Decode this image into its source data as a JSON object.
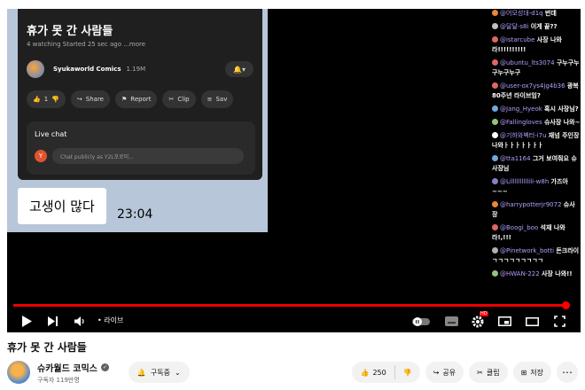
{
  "video": {
    "phone_screen": {
      "title": "휴가 못 간 사람들",
      "meta": "4 watching  Started 25 sec ago  ...more",
      "channel_name": "Syukaworld Comics",
      "channel_subs": "1.19M",
      "actions": [
        {
          "icon": "thumb-up-icon",
          "label": "1"
        },
        {
          "icon": "share-icon",
          "label": "Share"
        },
        {
          "icon": "flag-icon",
          "label": "Report"
        },
        {
          "icon": "scissors-icon",
          "label": "Clip"
        },
        {
          "icon": "save-icon",
          "label": "Sav"
        }
      ],
      "chat_title": "Live chat",
      "chat_avatar": "Y",
      "chat_placeholder": "Chat publicly as Y2L포로미..."
    },
    "subtitle_text": "고생이 많다",
    "subtitle_time": "23:04"
  },
  "chat_overlay": [
    {
      "name": "@어모성대-d1q",
      "text": "번데",
      "color": "#e9873a"
    },
    {
      "name": "@달달-s8i",
      "text": "이게 끝??",
      "color": "#c0c0c0"
    },
    {
      "name": "@istarcube",
      "text": "사장 나와라!!!!!!!!!!",
      "color": "#e06666"
    },
    {
      "name": "@ubuntu_lts3074",
      "text": "구누구누구누구누구",
      "color": "#e06666"
    },
    {
      "name": "@user-ox7ys4jg4b36",
      "text": "광복 80주년 라이브임?",
      "color": "#e06666"
    },
    {
      "name": "@Jang_Hyeok",
      "text": "혹시 사장님?",
      "color": "#6fa8dc"
    },
    {
      "name": "@Fallingloves",
      "text": "슈사장 나와~",
      "color": "#93c47d"
    },
    {
      "name": "@기하와벡터-i7u",
      "text": "재넘 주인장 나와ㅏㅏㅏㅏㅏㅏㅏ",
      "color": "#ffffff"
    },
    {
      "name": "@tta1164",
      "text": "그거 보여줘요 슈사장님",
      "color": "#6fa8dc"
    },
    {
      "name": "@Lillllllllllili-w8h",
      "text": "가즈아~~~",
      "color": "#8e7cc3"
    },
    {
      "name": "@harrypotterjr9072",
      "text": "슈사장",
      "color": "#e9873a"
    },
    {
      "name": "@Boogi_boo",
      "text": "석재 나와라!,!!!",
      "color": "#e06666"
    },
    {
      "name": "@Pinetwork_botti",
      "text": "돈크라이 ㄱㄱㄱㄱㄱㄱㄱㄱㄱ",
      "color": "#b0b0b0"
    },
    {
      "name": "@HWAN-222",
      "text": "사장 나와!!",
      "color": "#93c47d"
    }
  ],
  "player": {
    "live_label": "• 라이브",
    "progress": 1.0,
    "quality_badge": "HD"
  },
  "title": "휴가 못 간 사람들",
  "channel": {
    "name": "슈카월드 코믹스",
    "subs": "구독자 119만명",
    "subscribe_label": "구독중"
  },
  "actions": {
    "likes": "250",
    "share": "공유",
    "clip": "클립",
    "save": "저장"
  }
}
